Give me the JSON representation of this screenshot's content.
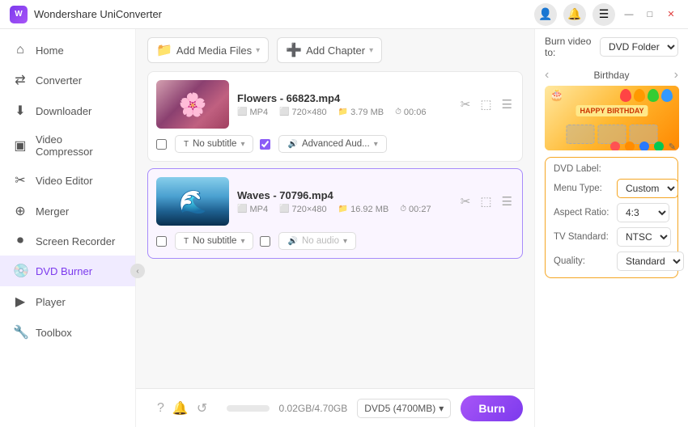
{
  "app": {
    "title": "Wondershare UniConverter",
    "logo_text": "W"
  },
  "titlebar": {
    "user_icon": "👤",
    "bell_icon": "🔔",
    "menu_icon": "☰",
    "minimize": "—",
    "maximize": "□",
    "close": "✕"
  },
  "sidebar": {
    "items": [
      {
        "id": "home",
        "label": "Home",
        "icon": "⌂"
      },
      {
        "id": "converter",
        "label": "Converter",
        "icon": "↔"
      },
      {
        "id": "downloader",
        "label": "Downloader",
        "icon": "⬇"
      },
      {
        "id": "video-compressor",
        "label": "Video Compressor",
        "icon": "⊡"
      },
      {
        "id": "video-editor",
        "label": "Video Editor",
        "icon": "✂"
      },
      {
        "id": "merger",
        "label": "Merger",
        "icon": "⊕"
      },
      {
        "id": "screen-recorder",
        "label": "Screen Recorder",
        "icon": "⏺"
      },
      {
        "id": "dvd-burner",
        "label": "DVD Burner",
        "icon": "💿",
        "active": true
      },
      {
        "id": "player",
        "label": "Player",
        "icon": "▶"
      },
      {
        "id": "toolbox",
        "label": "Toolbox",
        "icon": "🔧"
      }
    ]
  },
  "toolbar": {
    "add_media_label": "Add Media Files",
    "add_chapter_label": "Add Chapter"
  },
  "files": [
    {
      "id": "file1",
      "name": "Flowers - 66823.mp4",
      "format": "MP4",
      "resolution": "720×480",
      "size": "3.79 MB",
      "duration": "00:06",
      "subtitle": "No subtitle",
      "audio": "Advanced Aud...",
      "selected": false
    },
    {
      "id": "file2",
      "name": "Waves - 70796.mp4",
      "format": "MP4",
      "resolution": "720×480",
      "size": "16.92 MB",
      "duration": "00:27",
      "subtitle": "No subtitle",
      "audio": "No audio",
      "selected": true
    }
  ],
  "right_panel": {
    "burn_label": "Burn video to:",
    "burn_dest": "DVD Folder",
    "preview_title": "Birthday",
    "nav_left": "‹",
    "nav_right": "›",
    "birthday_text": "HAPPY BIRTHDAY",
    "dvd_label": "DVD Label:",
    "menu_type_label": "Menu Type:",
    "menu_type_value": "Custom",
    "aspect_ratio_label": "Aspect Ratio:",
    "aspect_ratio_value": "4:3",
    "tv_standard_label": "TV Standard:",
    "tv_standard_value": "NTSC",
    "quality_label": "Quality:",
    "quality_value": "Standard",
    "edit_icon": "✎"
  },
  "bottom": {
    "progress_text": "0.02GB/4.70GB",
    "disc_type": "DVD5 (4700MB)",
    "burn_btn": "Burn",
    "progress_pct": 0.5
  },
  "footer_icons": {
    "help": "?",
    "bell": "🔔",
    "refresh": "↺"
  },
  "balloons": [
    {
      "color": "#ff4444"
    },
    {
      "color": "#ff9900"
    },
    {
      "color": "#33cc33"
    },
    {
      "color": "#3399ff"
    }
  ],
  "preview_dots": [
    {
      "color": "#ff5252"
    },
    {
      "color": "#ff8c00"
    },
    {
      "color": "#2979ff"
    },
    {
      "color": "#00c853"
    }
  ]
}
